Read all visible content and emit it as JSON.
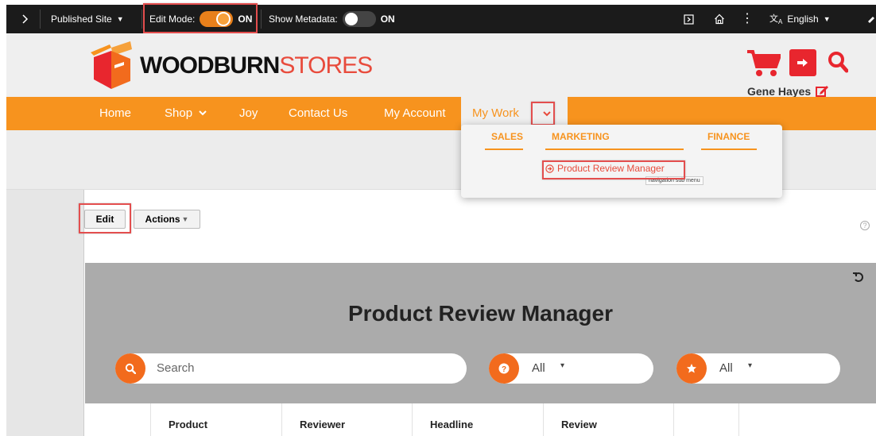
{
  "topbar": {
    "published_site": "Published Site",
    "edit_mode_label": "Edit Mode:",
    "edit_mode_state": "ON",
    "show_metadata_label": "Show Metadata:",
    "show_metadata_state": "ON",
    "language": "English"
  },
  "header": {
    "logo_bold": "WOODBURN",
    "logo_light": "STORES",
    "user_name": "Gene Hayes"
  },
  "nav": {
    "items": [
      "Home",
      "Shop",
      "Joy",
      "Contact Us",
      "My Account"
    ],
    "my_work": "My Work"
  },
  "dropdown": {
    "tabs": [
      "SALES",
      "MARKETING",
      "FINANCE"
    ],
    "link": "Product Review Manager",
    "tooltip": "navigation sub menu"
  },
  "toolbar": {
    "edit": "Edit",
    "actions": "Actions"
  },
  "panel": {
    "title": "Product Review Manager",
    "search_placeholder": "Search",
    "filter1": "All",
    "filter2": "All"
  },
  "table": {
    "columns": [
      "Product",
      "Reviewer",
      "Headline",
      "Review"
    ]
  },
  "colors": {
    "orange": "#f7931e",
    "red": "#e8262e",
    "panel_gray": "#ababab"
  }
}
